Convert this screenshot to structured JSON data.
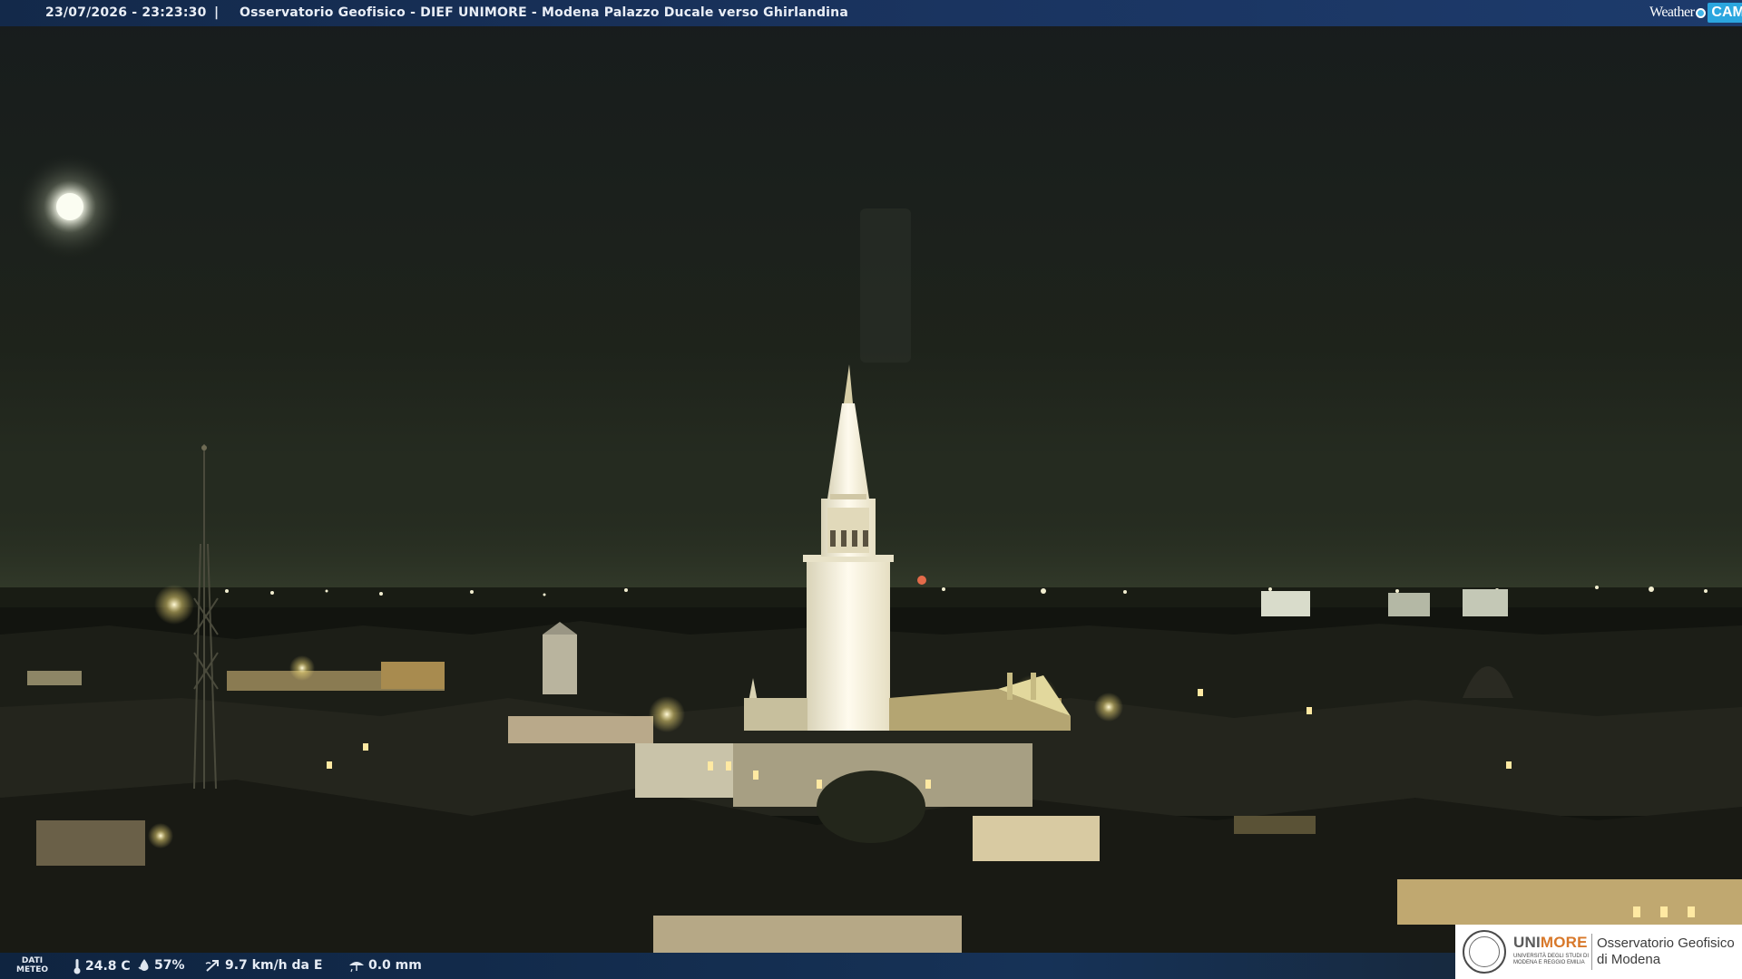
{
  "header": {
    "timestamp": "23/07/2026 - 23:23:30",
    "separator": "|",
    "title": "Osservatorio Geofisico - DIEF UNIMORE - Modena Palazzo Ducale verso Ghirlandina"
  },
  "logo": {
    "weather": "Weather",
    "cam": "CAM"
  },
  "weather_bar": {
    "label_line1": "DATI",
    "label_line2": "METEO",
    "temperature": "24.8 C",
    "humidity": "57%",
    "wind": "9.7 km/h da E",
    "rain": "0.0 mm"
  },
  "institution": {
    "name_part1": "UNI",
    "name_part2": "MORE",
    "subtitle": "UNIVERSITÀ DEGLI STUDI DI MODENA E REGGIO EMILIA",
    "observatory_line1": "Osservatorio Geofisico",
    "observatory_line2": "di Modena"
  },
  "colors": {
    "bar": "#1a3460",
    "accent": "#2ba6df",
    "unimore_orange": "#d8782a",
    "tower_light": "#fbf6e6",
    "sky": "#1c211a"
  },
  "icons": [
    "thermometer-icon",
    "humidity-drop-icon",
    "wind-icon",
    "rain-gauge-icon"
  ]
}
